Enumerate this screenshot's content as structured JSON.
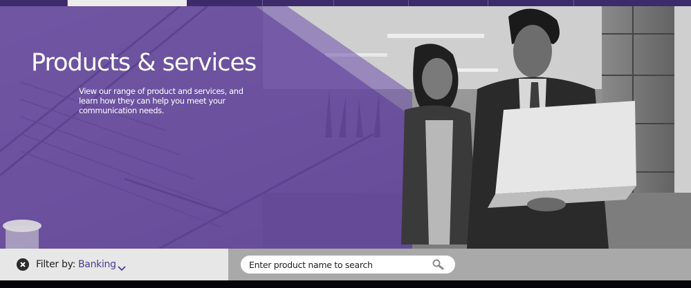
{
  "hero": {
    "title": "Products & services",
    "description": "View our range of product and services, and learn how they can help you meet your communication needs."
  },
  "filter": {
    "label": "Filter by:",
    "value": "Banking"
  },
  "search": {
    "placeholder": "Enter product name to search"
  },
  "colors": {
    "brand_purple": "#5f3f9e",
    "nav_purple": "#3d2a6b",
    "filter_value": "#4b3a8f"
  },
  "icons": {
    "clear": "close-circle-icon",
    "dropdown": "chevron-down-icon",
    "search": "magnifier-icon"
  }
}
